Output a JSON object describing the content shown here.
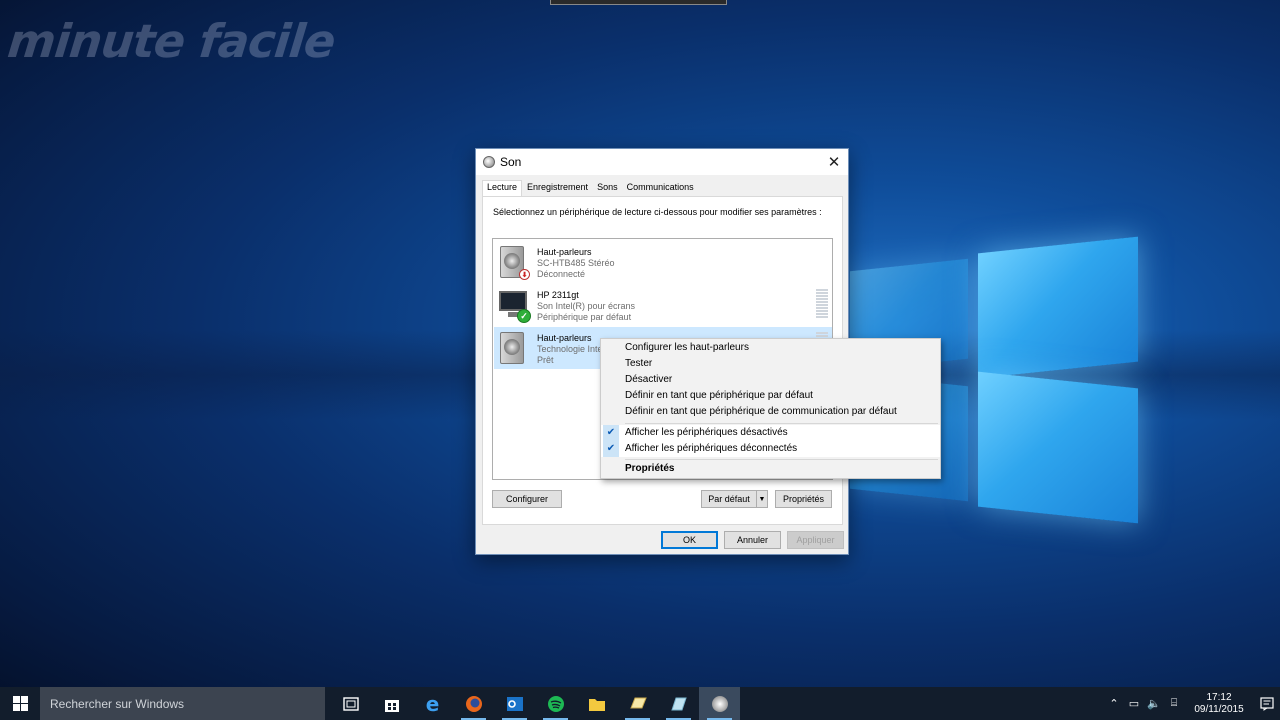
{
  "watermark": "minute facile",
  "dialog": {
    "title": "Son",
    "tabs": [
      "Lecture",
      "Enregistrement",
      "Sons",
      "Communications"
    ],
    "instruction": "Sélectionnez un périphérique de lecture ci-dessous pour modifier ses paramètres :",
    "devices": [
      {
        "name": "Haut-parleurs",
        "line1": "SC-HTB485 Stéréo",
        "line2": "Déconnecté",
        "icon": "speaker-icon",
        "status": "disconnected"
      },
      {
        "name": "HP 2311gt",
        "line1": "Son Intel(R) pour écrans",
        "line2": "Périphérique par défaut",
        "icon": "monitor-icon",
        "status": "default"
      },
      {
        "name": "Haut-parleurs",
        "line1": "Technologie Intel",
        "line2": "Prêt",
        "icon": "speaker-icon",
        "status": "ready"
      }
    ],
    "buttons": {
      "configure": "Configurer",
      "set_default": "Par défaut",
      "properties": "Propriétés",
      "ok": "OK",
      "cancel": "Annuler",
      "apply": "Appliquer"
    }
  },
  "context_menu": {
    "items": [
      "Configurer les haut-parleurs",
      "Tester",
      "Désactiver",
      "Définir en tant que périphérique par défaut",
      "Définir en tant que périphérique de communication par défaut"
    ],
    "checked_items": [
      "Afficher les périphériques désactivés",
      "Afficher les périphériques déconnectés"
    ],
    "properties": "Propriétés"
  },
  "taskbar": {
    "search_placeholder": "Rechercher sur Windows",
    "time": "17:12",
    "date": "09/11/2015"
  },
  "colors": {
    "accent": "#0078d7",
    "selection": "#cde8ff",
    "taskbar": "#121d2c"
  }
}
